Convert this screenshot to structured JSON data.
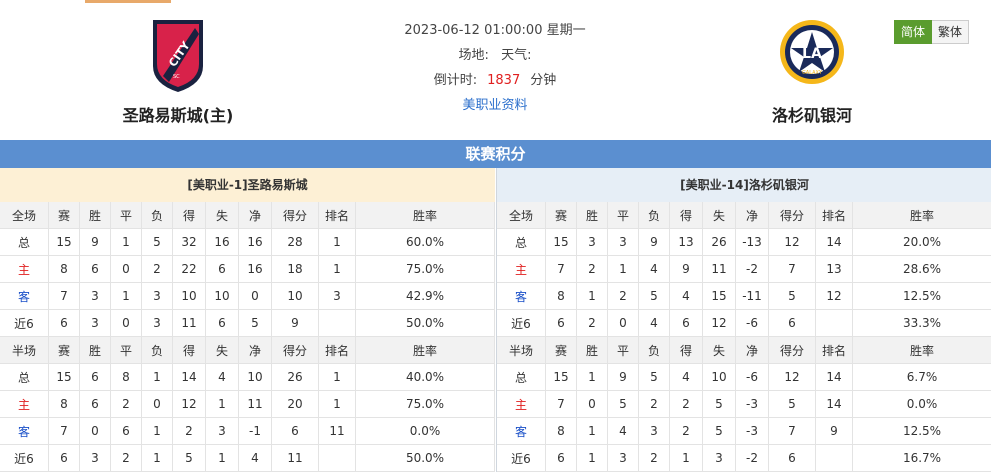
{
  "header": {
    "datetime": "2023-06-12 01:00:00 星期一",
    "venue_label": "场地:",
    "weather_label": "天气:",
    "countdown_label": "倒计时:",
    "countdown_value": "1837",
    "countdown_unit": "分钟",
    "league_link": "美职业资料"
  },
  "home_team": {
    "name": "圣路易斯城(主)",
    "logo_text": "CITY",
    "logo_sub": "ST. LOUIS",
    "logo_sc": "SC"
  },
  "away_team": {
    "name": "洛杉矶银河",
    "logo_text": "LA",
    "logo_sub": "GALAXY"
  },
  "lang": {
    "simplified": "简体",
    "traditional": "繁体"
  },
  "section_title": "联赛积分",
  "columns_full": [
    "全场",
    "赛",
    "胜",
    "平",
    "负",
    "得",
    "失",
    "净",
    "得分",
    "排名",
    "胜率"
  ],
  "columns_half": [
    "半场",
    "赛",
    "胜",
    "平",
    "负",
    "得",
    "失",
    "净",
    "得分",
    "排名",
    "胜率"
  ],
  "home_standings": {
    "title": "[美职业-1]圣路易斯城",
    "full": [
      [
        "总",
        "15",
        "9",
        "1",
        "5",
        "32",
        "16",
        "16",
        "28",
        "1",
        "60.0%"
      ],
      [
        "主",
        "8",
        "6",
        "0",
        "2",
        "22",
        "6",
        "16",
        "18",
        "1",
        "75.0%"
      ],
      [
        "客",
        "7",
        "3",
        "1",
        "3",
        "10",
        "10",
        "0",
        "10",
        "3",
        "42.9%"
      ],
      [
        "近6",
        "6",
        "3",
        "0",
        "3",
        "11",
        "6",
        "5",
        "9",
        "",
        "50.0%"
      ]
    ],
    "half": [
      [
        "总",
        "15",
        "6",
        "8",
        "1",
        "14",
        "4",
        "10",
        "26",
        "1",
        "40.0%"
      ],
      [
        "主",
        "8",
        "6",
        "2",
        "0",
        "12",
        "1",
        "11",
        "20",
        "1",
        "75.0%"
      ],
      [
        "客",
        "7",
        "0",
        "6",
        "1",
        "2",
        "3",
        "-1",
        "6",
        "11",
        "0.0%"
      ],
      [
        "近6",
        "6",
        "3",
        "2",
        "1",
        "5",
        "1",
        "4",
        "11",
        "",
        "50.0%"
      ]
    ]
  },
  "away_standings": {
    "title": "[美职业-14]洛杉矶银河",
    "full": [
      [
        "总",
        "15",
        "3",
        "3",
        "9",
        "13",
        "26",
        "-13",
        "12",
        "14",
        "20.0%"
      ],
      [
        "主",
        "7",
        "2",
        "1",
        "4",
        "9",
        "11",
        "-2",
        "7",
        "13",
        "28.6%"
      ],
      [
        "客",
        "8",
        "1",
        "2",
        "5",
        "4",
        "15",
        "-11",
        "5",
        "12",
        "12.5%"
      ],
      [
        "近6",
        "6",
        "2",
        "0",
        "4",
        "6",
        "12",
        "-6",
        "6",
        "",
        "33.3%"
      ]
    ],
    "half": [
      [
        "总",
        "15",
        "1",
        "9",
        "5",
        "4",
        "10",
        "-6",
        "12",
        "14",
        "6.7%"
      ],
      [
        "主",
        "7",
        "0",
        "5",
        "2",
        "2",
        "5",
        "-3",
        "5",
        "14",
        "0.0%"
      ],
      [
        "客",
        "8",
        "1",
        "4",
        "3",
        "2",
        "5",
        "-3",
        "7",
        "9",
        "12.5%"
      ],
      [
        "近6",
        "6",
        "1",
        "3",
        "2",
        "1",
        "3",
        "-2",
        "6",
        "",
        "16.7%"
      ]
    ]
  },
  "colors": {
    "accent_blue": "#5b8fd0",
    "home_red": "#e02020",
    "away_blue": "#1a50c8",
    "lang_green": "#5a9c2e"
  }
}
